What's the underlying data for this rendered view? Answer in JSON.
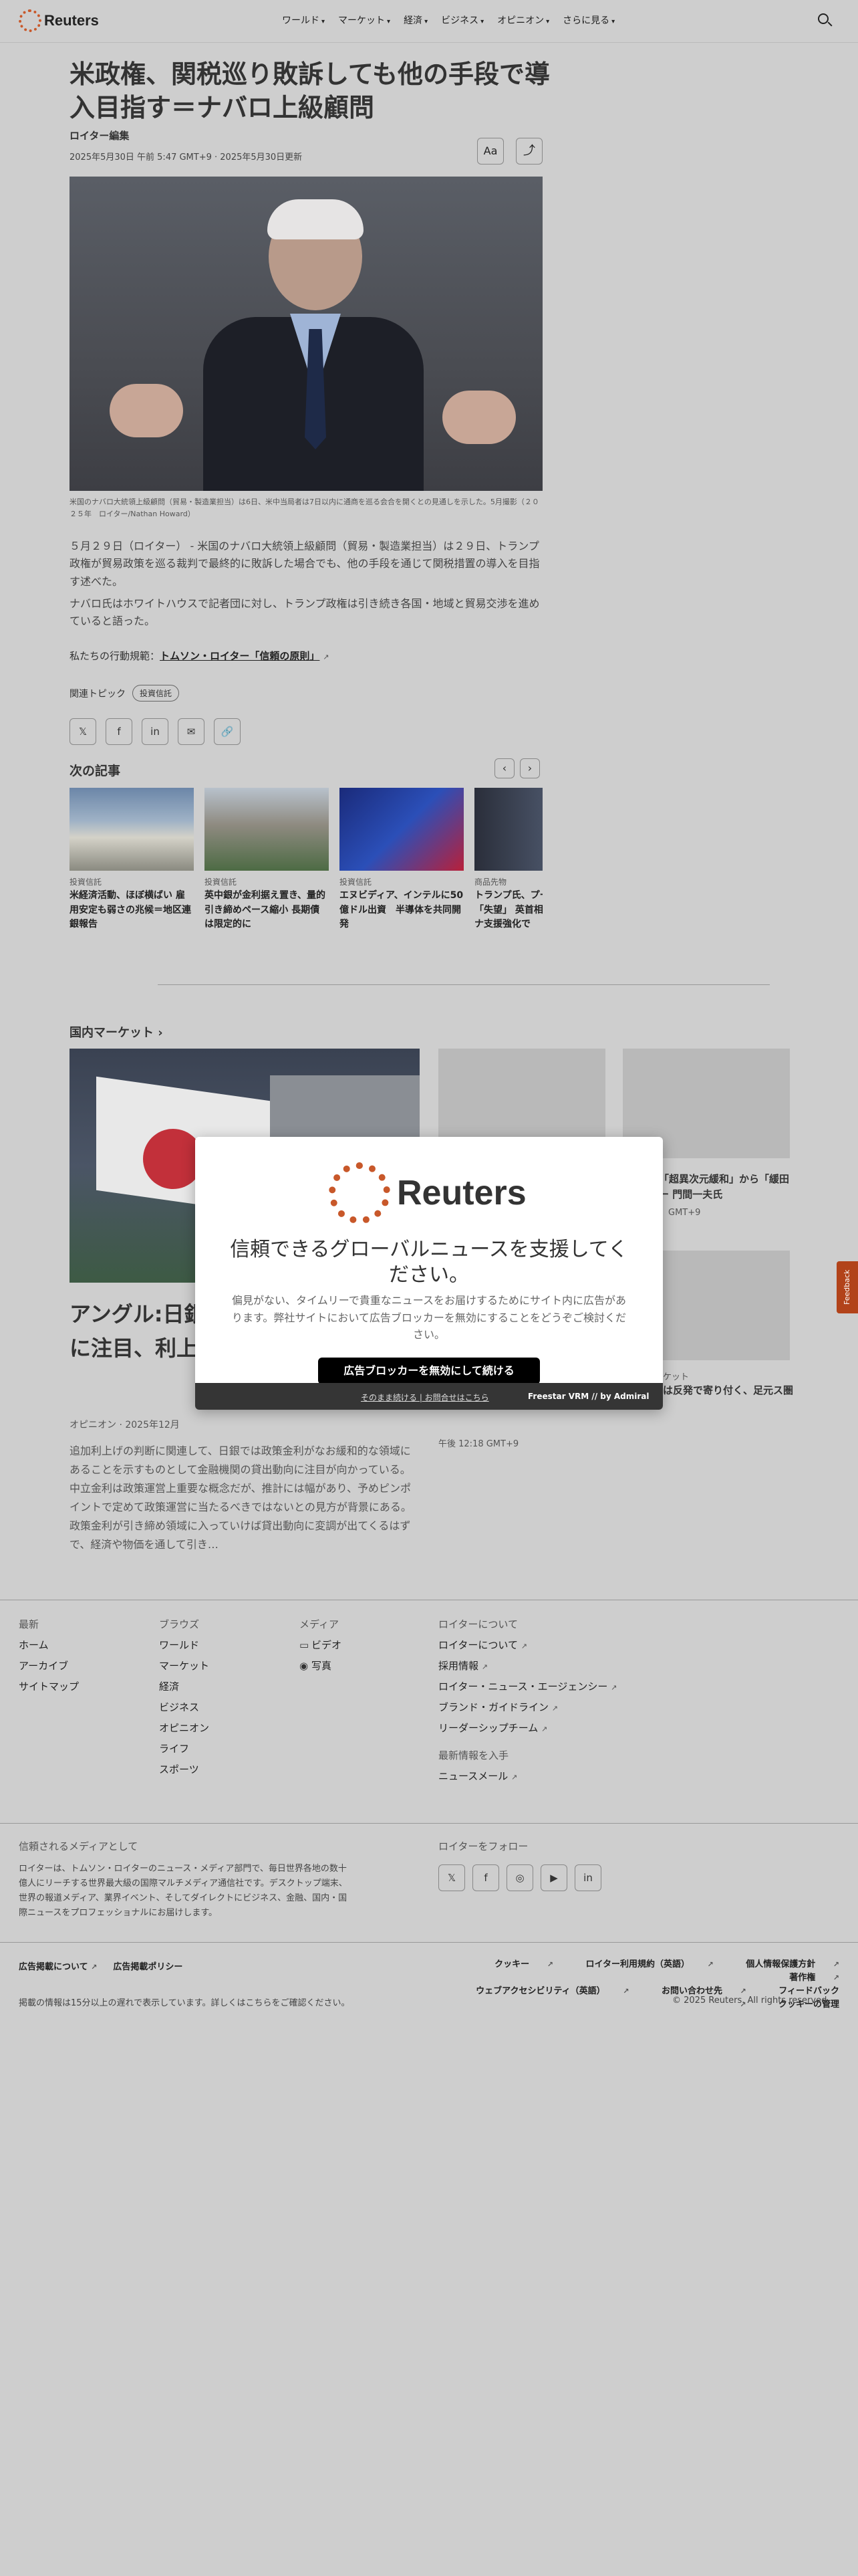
{
  "header": {
    "logo_text": "Reuters",
    "nav": [
      "ワールド",
      "マーケット",
      "経済",
      "ビジネス",
      "オピニオン",
      "さらに見る"
    ],
    "search_icon": "search-icon"
  },
  "article": {
    "title": "米政権、関税巡り敗訴しても他の手段で導入目指す＝ナバロ上級顧問",
    "byline": "ロイター編集",
    "dateline": "2025年5月30日 午前 5:47 GMT+9 · 2025年5月30日更新",
    "text_size_label": "Aa",
    "caption": "米国のナバロ大統領上級顧問（貿易・製造業担当）は6日、米中当局者は7日以内に通商を巡る会合を開くとの見通しを示した。5月撮影（２０２５年　ロイター/Nathan Howard）",
    "paragraphs": [
      "５月２９日（ロイター） - 米国のナバロ大統領上級顧問（貿易・製造業担当）は２９日、トランプ政権が貿易政策を巡る裁判で最終的に敗訴した場合でも、他の手段を通じて関税措置の導入を目指す述べた。",
      "ナバロ氏はホワイトハウスで記者団に対し、トランプ政権は引き続き各国・地域と貿易交渉を進めていると語った。"
    ],
    "conduct_prefix": "私たちの行動規範：",
    "conduct_link": "トムソン・ロイター「信頼の原則」",
    "related_label": "関連トピック",
    "related_topic": "投資信託"
  },
  "share": {
    "icons": [
      "x-icon",
      "facebook-icon",
      "linkedin-icon",
      "email-icon",
      "link-icon"
    ]
  },
  "next_articles": {
    "heading": "次の記事",
    "items": [
      {
        "category": "投資信託",
        "title": "米経済活動、ほぼ横ばい 雇用安定も弱さの兆候＝地区連銀報告"
      },
      {
        "category": "投資信託",
        "title": "英中銀が金利据え置き、量的引き締めペース縮小 長期債は限定的に"
      },
      {
        "category": "投資信託",
        "title": "エヌビディア、インテルに50億ドル出資　半導体を共同開発"
      },
      {
        "category": "商品先物",
        "title": "トランプ氏、プーチン氏に「失望」 英首相とウクライナ支援強化で"
      }
    ]
  },
  "domestic_market": {
    "heading": "国内マーケット",
    "main_title": "アングル:日銀、政策金利の貸出動向に注目、利上げの確実性",
    "main_meta": "オピニオン · 2025年12月",
    "main_desc": "追加利上げの判断に関連して、日銀では政策金利がなお緩和的な領域にあることを示すものとして金融機関の貸出動向に注目が向かっている。中立金利は政策運営上重要な概念だが、推計には幅があり、予めピンポイントで定めて政策運営に当たるべきではないとの見方が背景にある。政策金利が引き締め領域に入っていけば貸出動向に変調が出てくるはずで、経済や物価を通して引き…",
    "side1_title": "「超異次元緩和」から「緩田ー 門間一夫氏",
    "side1_meta": "GMT+9",
    "side2_category": "ケット",
    "side2_title": "は反発で寄り付く、足元ス圏",
    "side2_meta": "午後 12:18 GMT+9"
  },
  "modal": {
    "logo_text": "Reuters",
    "heading": "信頼できるグローバルニュースを支援してください。",
    "body": "偏見がない、タイムリーで貴重なニュースをお届けするためにサイト内に広告があります。弊社サイトにおいて広告ブロッカーを無効にすることをどうぞご検討ください。",
    "button": "広告ブロッカーを無効にして続ける",
    "footer_links": "そのまま続ける | お問合せはこちら",
    "footer_brand": "Freestar VRM  // by Admiral"
  },
  "feedback_label": "Feedback",
  "footer": {
    "col1": {
      "heading": "最新",
      "items": [
        "ホーム",
        "アーカイブ",
        "サイトマップ"
      ]
    },
    "col2": {
      "heading": "ブラウズ",
      "items": [
        "ワールド",
        "マーケット",
        "経済",
        "ビジネス",
        "オピニオン",
        "ライフ",
        "スポーツ"
      ]
    },
    "col3": {
      "heading": "メディア",
      "items": [
        "ビデオ",
        "写真"
      ]
    },
    "col4": {
      "heading": "ロイターについて",
      "items": [
        "ロイターについて",
        "採用情報",
        "ロイター・ニュース・エージェンシー",
        "ブランド・ガイドライン",
        "リーダーシップチーム"
      ]
    },
    "col4b": {
      "heading": "最新情報を入手",
      "items": [
        "ニュースメール"
      ]
    },
    "trust_heading": "信頼されるメディアとして",
    "trust_text": "ロイターは、トムソン・ロイターのニュース・メディア部門で、毎日世界各地の数十億人にリーチする世界最大級の国際マルチメディア通信社です。デスクトップ端末、世界の報道メディア、業界イベント、そしてダイレクトにビジネス、金融、国内・国際ニュースをプロフェッショナルにお届けします。",
    "follow_heading": "ロイターをフォロー",
    "legal_left": [
      "広告掲載について",
      "広告掲載ポリシー"
    ],
    "legal_right_1": [
      "クッキー",
      "ロイター利用規約（英語）",
      "個人情報保護方針",
      "著作権"
    ],
    "legal_right_2": [
      "ウェブアクセシビリティ（英語）",
      "お問い合わせ先",
      "フィードバック",
      "クッキーの管理"
    ],
    "delay_notice": "掲載の情報は15分以上の遅れで表示しています。詳しくはこちらをご確認ください。",
    "copyright": "© 2025 Reuters. All rights reserved"
  }
}
